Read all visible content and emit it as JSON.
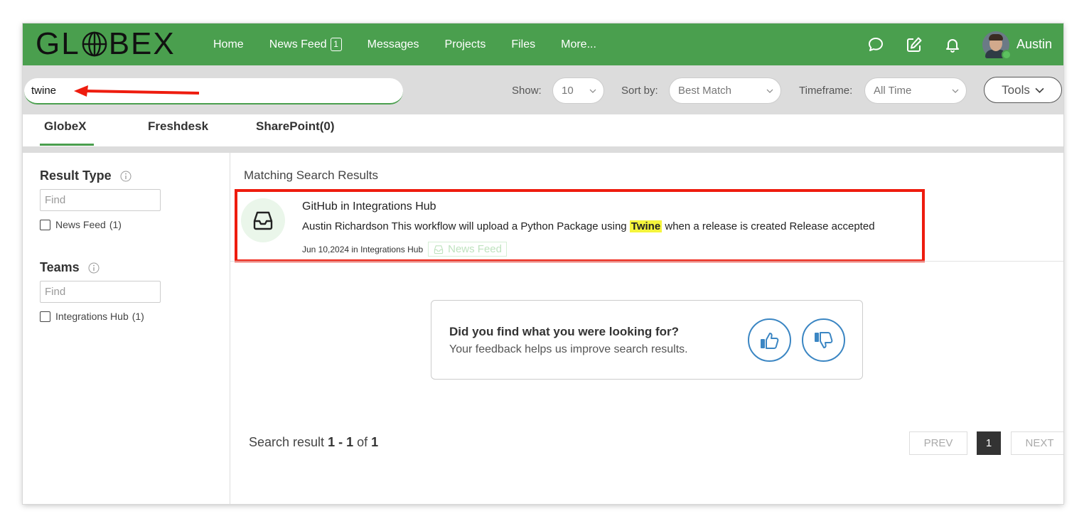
{
  "header": {
    "logo_text": "GLOBEX",
    "nav": [
      {
        "label": "Home"
      },
      {
        "label": "News Feed",
        "badge": "1"
      },
      {
        "label": "Messages"
      },
      {
        "label": "Projects"
      },
      {
        "label": "Files"
      },
      {
        "label": "More..."
      }
    ],
    "user_name": "Austin",
    "brand_color": "#4a9f4e"
  },
  "search": {
    "query": "twine",
    "show_label": "Show:",
    "show_value": "10",
    "sort_label": "Sort by:",
    "sort_value": "Best Match",
    "timeframe_label": "Timeframe:",
    "timeframe_value": "All Time",
    "tools_label": "Tools"
  },
  "tabs": [
    {
      "label": "GlobeX",
      "active": true
    },
    {
      "label": "Freshdesk"
    },
    {
      "label": "SharePoint(0)"
    }
  ],
  "sidebar": {
    "result_type": {
      "title": "Result Type",
      "find_placeholder": "Find",
      "options": [
        {
          "label": "News Feed",
          "count": "(1)"
        }
      ]
    },
    "teams": {
      "title": "Teams",
      "find_placeholder": "Find",
      "options": [
        {
          "label": "Integrations Hub",
          "count": "(1)"
        }
      ]
    }
  },
  "results": {
    "section_title": "Matching Search Results",
    "items": [
      {
        "title": "GitHub in Integrations Hub",
        "snippet_before": "Austin Richardson This workflow will upload a Python Package using ",
        "snippet_highlight": "Twine",
        "snippet_after": " when a release is created Release accepted",
        "meta": "Jun 10,2024 in Integrations Hub",
        "badge": "News Feed"
      }
    ]
  },
  "feedback": {
    "question": "Did you find what you were looking for?",
    "subtext": "Your feedback helps us improve search results."
  },
  "pagination": {
    "summary_prefix": "Search result ",
    "range": "1 - 1",
    "of_text": " of ",
    "total": "1",
    "prev_label": "PREV",
    "current_page": "1",
    "next_label": "NEXT"
  }
}
